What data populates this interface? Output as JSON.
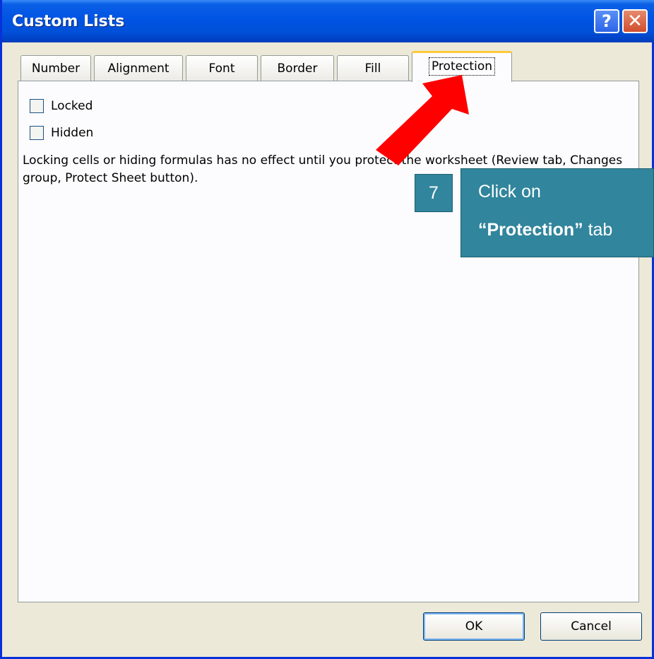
{
  "window": {
    "title": "Custom Lists",
    "help_glyph": "?",
    "close_glyph": "✕"
  },
  "tabs": [
    {
      "label": "Number",
      "active": false
    },
    {
      "label": "Alignment",
      "active": false
    },
    {
      "label": "Font",
      "active": false
    },
    {
      "label": "Border",
      "active": false
    },
    {
      "label": "Fill",
      "active": false
    },
    {
      "label": "Protection",
      "active": true
    }
  ],
  "protection": {
    "locked": {
      "label": "Locked",
      "checked": false
    },
    "hidden": {
      "label": "Hidden",
      "checked": false
    },
    "note": "Locking cells or hiding formulas has no effect until you protect the worksheet (Review tab, Changes group, Protect Sheet button)."
  },
  "buttons": {
    "ok": "OK",
    "cancel": "Cancel"
  },
  "annotation": {
    "step": "7",
    "line1": "Click on",
    "bold_text": "“Protection”",
    "line2_rest": " tab",
    "arrow_color": "#ff0000",
    "box_color": "#31859c"
  },
  "colors": {
    "titlebar": "#0054e3",
    "dialog_bg": "#ece9d8",
    "active_tab_accent": "#ffc83c"
  }
}
